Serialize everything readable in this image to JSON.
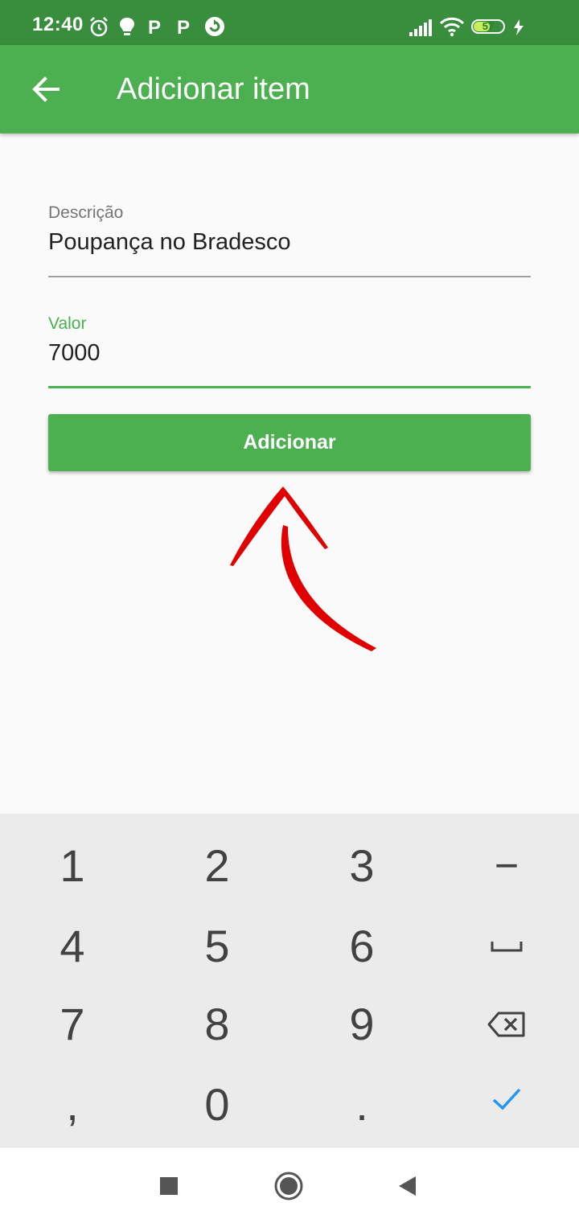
{
  "status_bar": {
    "time": "12:40",
    "notification_icons": [
      "alarm-icon",
      "bulb-icon",
      "p-icon",
      "p-icon",
      "sync-icon"
    ],
    "p_glyph": "P",
    "battery_level": "57",
    "battery_percent": 57
  },
  "app_bar": {
    "title": "Adicionar item",
    "back_icon": "arrow-left-icon"
  },
  "form": {
    "descricao": {
      "label": "Descrição",
      "value": "Poupança no Bradesco"
    },
    "valor": {
      "label": "Valor",
      "value": "7000"
    },
    "submit_label": "Adicionar"
  },
  "keyboard": {
    "rows": [
      [
        "1",
        "2",
        "3",
        "−"
      ],
      [
        "4",
        "5",
        "6",
        "space-icon"
      ],
      [
        "7",
        "8",
        "9",
        "backspace-icon"
      ],
      [
        ",",
        "0",
        ".",
        "check-icon"
      ]
    ]
  },
  "colors": {
    "status_bar": "#388e3c",
    "app_bar": "#4caf50",
    "accent": "#4caf50",
    "annotation": "#e00000",
    "check_blue": "#2196f3"
  }
}
